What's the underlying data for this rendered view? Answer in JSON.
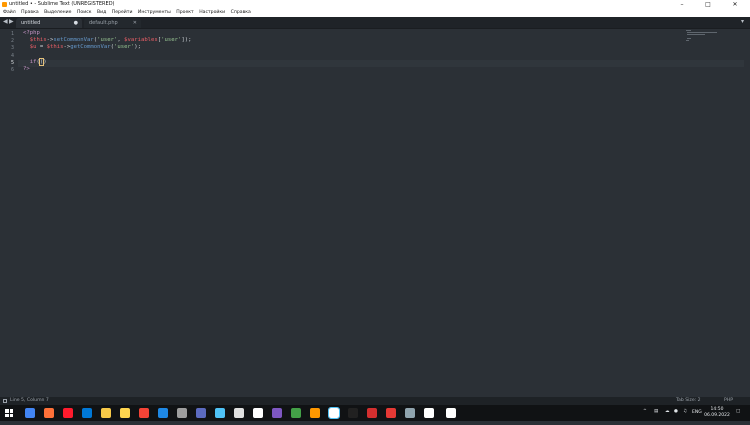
{
  "window": {
    "title": "untitled • - Sublime Text (UNREGISTERED)",
    "minimize_icon": "minimize-icon",
    "maximize_icon": "maximize-icon",
    "close_icon": "close-icon"
  },
  "menu": {
    "items": [
      "Файл",
      "Правка",
      "Выделение",
      "Поиск",
      "Вид",
      "Перейти",
      "Инструменты",
      "Проект",
      "Настройки",
      "Справка"
    ]
  },
  "tabs": {
    "items": [
      {
        "label": "untitled",
        "active": true
      },
      {
        "label": "default.php",
        "active": false
      }
    ]
  },
  "editor": {
    "line_numbers": [
      "1",
      "2",
      "3",
      "4",
      "5",
      "6"
    ],
    "current_line": 5
  },
  "status": {
    "position": "Line 5, Column 7",
    "tab_size": "Tab Size: 2",
    "syntax": "PHP"
  },
  "taskbar": {
    "language": "ENG",
    "time": "14:50",
    "date": "06.09.2022",
    "colors": [
      "#4285f4",
      "#ff7139",
      "#ff1b2d",
      "#0078d7",
      "#f7c948",
      "#ffd54f",
      "#f44336",
      "#1e88e5",
      "#9e9e9e",
      "#5c6bc0",
      "#4fc3f7",
      "#e0e0e0",
      "#ffffff",
      "#7e57c2",
      "#43a047",
      "#ff9800",
      "#ffffff",
      "#212121",
      "#d32f2f",
      "#e53935",
      "#90a4ae",
      "#ffffff",
      "#ffffff"
    ]
  }
}
